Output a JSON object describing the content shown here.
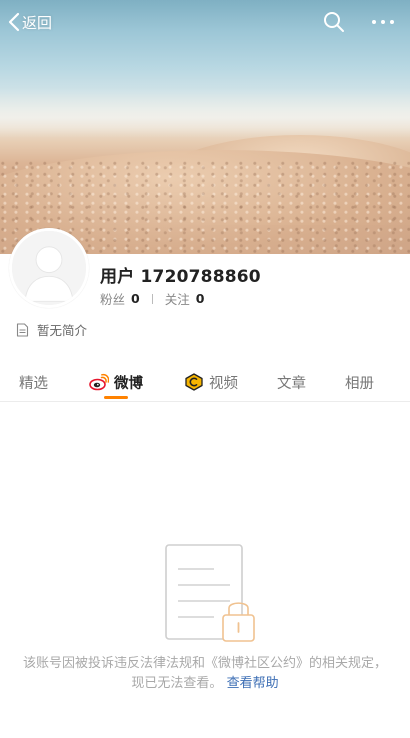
{
  "nav": {
    "back_label": "返回",
    "search_icon": "search-icon",
    "more_icon": "more-icon"
  },
  "profile": {
    "username": "用户 1720788860",
    "followers_label": "粉丝",
    "followers_count": "0",
    "following_label": "关注",
    "following_count": "0",
    "intro": "暂无简介"
  },
  "tabs": [
    {
      "label": "精选",
      "icon": ""
    },
    {
      "label": "微博",
      "icon": "weibo-icon",
      "active": true
    },
    {
      "label": "视频",
      "icon": "video-icon"
    },
    {
      "label": "文章",
      "icon": ""
    },
    {
      "label": "相册",
      "icon": ""
    }
  ],
  "notice": {
    "text": "该账号因被投诉违反法律法规和《微博社区公约》的相关规定，现已无法查看。",
    "link": "查看帮助"
  },
  "colors": {
    "accent": "#ff8200",
    "link": "#3e6fb5",
    "muted_text": "#a9a9a9"
  }
}
